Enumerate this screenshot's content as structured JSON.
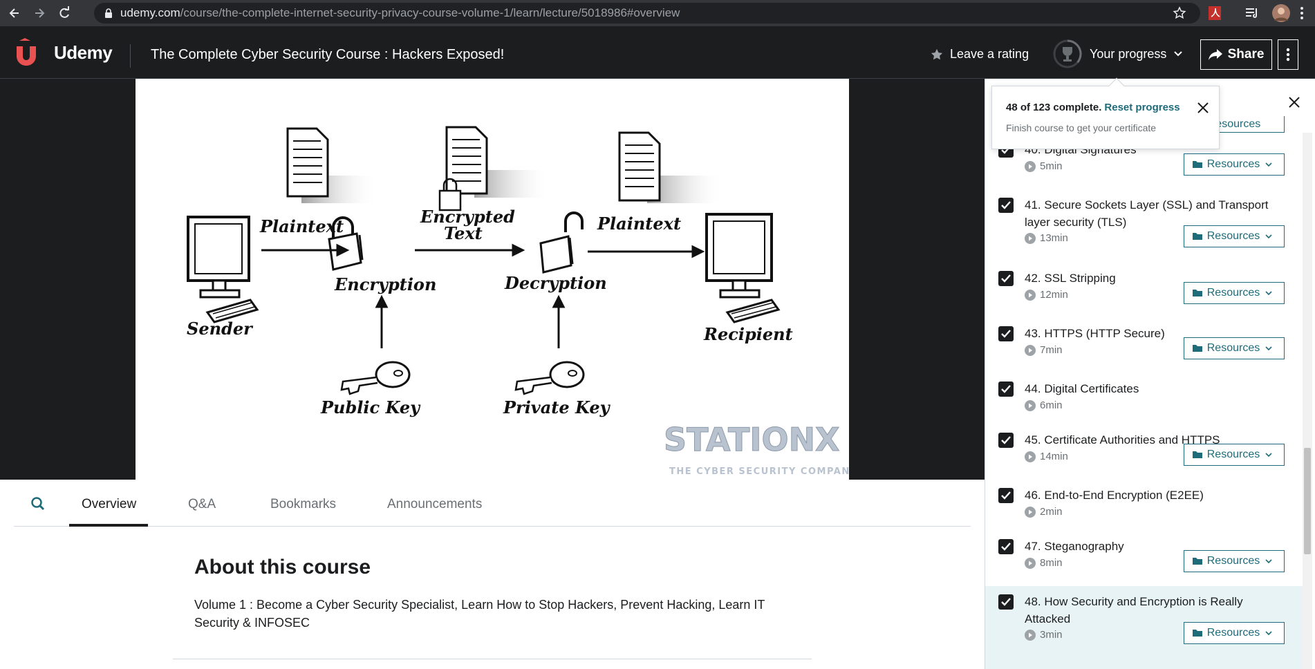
{
  "browser": {
    "url_host": "udemy.com",
    "url_path": "/course/the-complete-internet-security-privacy-course-volume-1/learn/lecture/5018986#overview"
  },
  "header": {
    "logo_text": "Udemy",
    "course_title": "The Complete Cyber Security Course : Hackers Exposed!",
    "rating_label": "Leave a rating",
    "progress_label": "Your progress",
    "share_label": "Share"
  },
  "progress_popover": {
    "complete_text": "48 of 123 complete.",
    "reset_label": "Reset progress",
    "subtext": "Finish course to get your certificate"
  },
  "video": {
    "diagram_labels": {
      "sender": "Sender",
      "plaintext_left": "Plaintext",
      "encrypted_line1": "Encrypted",
      "encrypted_line2": "Text",
      "plaintext_right": "Plaintext",
      "encryption": "Encryption",
      "decryption": "Decryption",
      "recipient": "Recipient",
      "public_key": "Public Key",
      "private_key": "Private Key"
    },
    "watermark_title": "STATIONX",
    "watermark_sub": "THE CYBER SECURITY COMPANY"
  },
  "tabs": [
    "Overview",
    "Q&A",
    "Bookmarks",
    "Announcements"
  ],
  "about": {
    "title": "About this course",
    "text": "Volume 1 : Become a Cyber Security Specialist, Learn How to Stop Hackers, Prevent Hacking, Learn IT Security & INFOSEC"
  },
  "sidebar": {
    "resources_label": "Resources",
    "lectures": [
      {
        "title": "40. Digital Signatures",
        "duration": "5min",
        "has_resources": true
      },
      {
        "title": "41. Secure Sockets Layer (SSL) and Transport layer security (TLS)",
        "duration": "13min",
        "has_resources": true
      },
      {
        "title": "42. SSL Stripping",
        "duration": "12min",
        "has_resources": true
      },
      {
        "title": "43. HTTPS (HTTP Secure)",
        "duration": "7min",
        "has_resources": true
      },
      {
        "title": "44. Digital Certificates",
        "duration": "6min",
        "has_resources": false
      },
      {
        "title": "45. Certificate Authorities and HTTPS",
        "duration": "14min",
        "has_resources": true
      },
      {
        "title": "46. End-to-End Encryption (E2EE)",
        "duration": "2min",
        "has_resources": false
      },
      {
        "title": "47. Steganography",
        "duration": "8min",
        "has_resources": true
      },
      {
        "title": "48. How Security and Encryption is Really Attacked",
        "duration": "3min",
        "has_resources": true
      }
    ]
  },
  "colors": {
    "udemy_dark": "#1c1d1f",
    "udemy_purple": "#5022c3",
    "teal": "#1e6b7a",
    "logo_red": "#ea5252"
  }
}
